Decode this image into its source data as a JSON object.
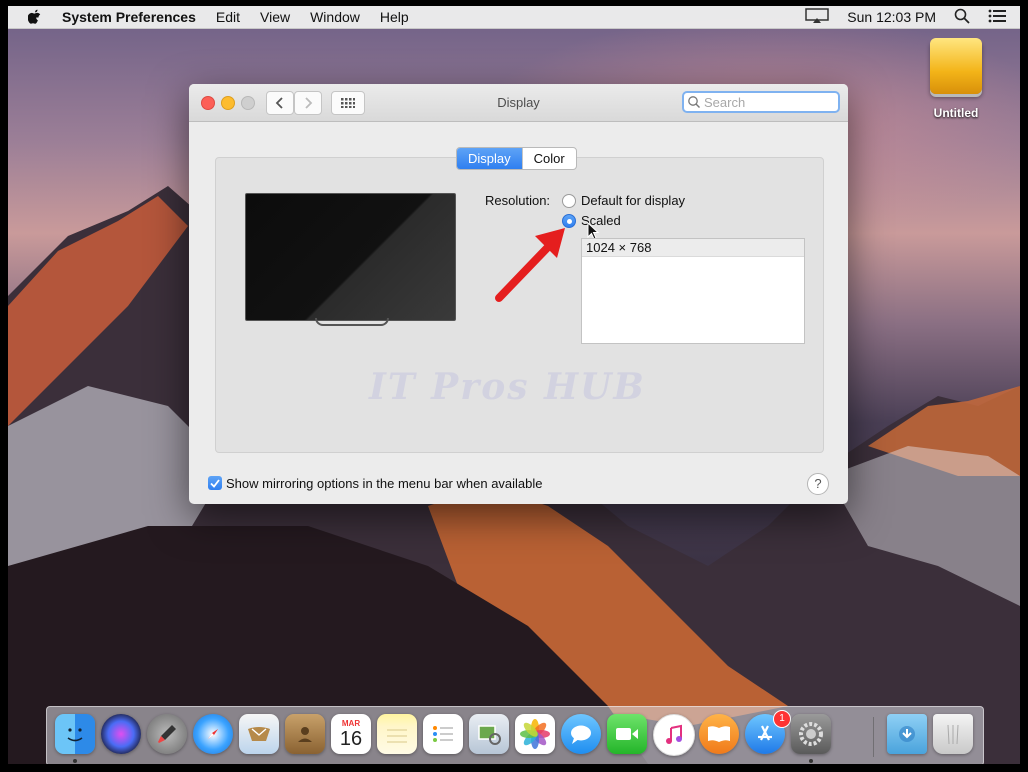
{
  "menubar": {
    "app_name": "System Preferences",
    "menus": [
      "Edit",
      "View",
      "Window",
      "Help"
    ],
    "clock": "Sun 12:03 PM"
  },
  "desktop": {
    "drive_label": "Untitled"
  },
  "window": {
    "title": "Display",
    "search_placeholder": "Search",
    "tabs": [
      {
        "label": "Display",
        "selected": true
      },
      {
        "label": "Color",
        "selected": false
      }
    ],
    "resolution_label": "Resolution:",
    "options": [
      {
        "label": "Default for display",
        "selected": false
      },
      {
        "label": "Scaled",
        "selected": true
      }
    ],
    "resolutions": [
      "1024 × 768"
    ],
    "watermark": "IT Pros HUB",
    "mirroring_label": "Show mirroring options in the menu bar when available",
    "mirroring_checked": true,
    "help": "?"
  },
  "dock": {
    "calendar": {
      "month": "MAR",
      "day": "16"
    },
    "app_store_badge": "1",
    "items": [
      "finder-icon",
      "siri-icon",
      "launchpad-icon",
      "safari-icon",
      "mail-icon",
      "contacts-icon",
      "calendar-icon",
      "notes-icon",
      "reminders-icon",
      "preview-icon",
      "photos-icon",
      "messages-icon",
      "facetime-icon",
      "itunes-icon",
      "ibooks-icon",
      "app-store-icon",
      "system-preferences-icon",
      "downloads-icon",
      "trash-icon"
    ]
  },
  "colors": {
    "accent": "#2f7ff0",
    "arrow": "#e51e1e"
  }
}
